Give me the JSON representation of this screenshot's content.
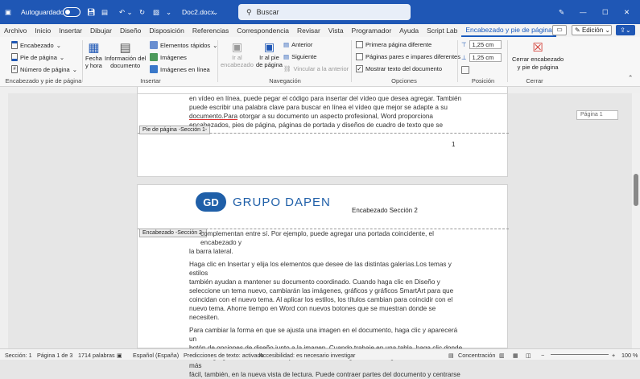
{
  "titlebar": {
    "autosave": "Autoguardado",
    "doc": "Doc2.docx",
    "search_placeholder": "Buscar",
    "chevron": "⌄"
  },
  "tabs": [
    "Archivo",
    "Inicio",
    "Insertar",
    "Dibujar",
    "Diseño",
    "Disposición",
    "Referencias",
    "Correspondencia",
    "Revisar",
    "Vista",
    "Programador",
    "Ayuda",
    "Script Lab",
    "Encabezado y pie de página"
  ],
  "ribbon_right": {
    "edit": "Edición"
  },
  "ribbon": {
    "header": "Encabezado",
    "footer": "Pie de página",
    "pagenum": "Número de página",
    "g1": "Encabezado y pie de página",
    "datetime1": "Fecha",
    "datetime2": "y hora",
    "docinfo1": "Información del",
    "docinfo2": "documento",
    "quick": "Elementos rápidos",
    "images": "Imágenes",
    "online": "Imágenes en línea",
    "g2": "Insertar",
    "goto_header1": "Ir al",
    "goto_header2": "encabezado",
    "goto_footer1": "Ir al pie",
    "goto_footer2": "de página",
    "prev": "Anterior",
    "next": "Siguiente",
    "link": "Vincular a la anterior",
    "g3": "Navegación",
    "first": "Primera página diferente",
    "oddeven": "Páginas pares e impares diferentes",
    "showtext": "Mostrar texto del documento",
    "g4": "Opciones",
    "top": "1,25 cm",
    "bottom": "1,25 cm",
    "g5": "Posición",
    "close1": "Cerrar encabezado",
    "close2": "y pie de página",
    "g6": "Cerrar"
  },
  "page1": {
    "l1": "en vídeo en línea, puede pegar el código para insertar del vídeo que desea agregar. También",
    "l2": "puede escribir una palabra clave para buscar en línea el vídeo que mejor se adapte a su",
    "l3a": "documento.Para",
    "l3b": " otorgar a su documento un aspecto profesional, Word proporciona",
    "l4": "encabezados, pies de página, páginas de portada y diseños de cuadro de texto que se",
    "footer_tag": "Pie de página -Sección 1-",
    "pagenum": "1"
  },
  "page2": {
    "logo_letters": "GD",
    "logo_text": "GRUPO DAPEN",
    "header_text": "Encabezado Sección 2",
    "header_tag": "Encabezado -Sección 2-",
    "p0a": "complementan entre sí. Por ejemplo, puede agregar una portada coincidente, el encabezado y",
    "p0b": "la barra lateral.",
    "p1": [
      "Haga clic en Insertar y elija los elementos que desee de las distintas galerías.Los temas y estilos",
      "también ayudan a mantener su documento coordinado. Cuando haga clic en Diseño y",
      "seleccione un tema nuevo, cambiarán las imágenes, gráficos y gráficos SmartArt para que",
      "coincidan con el nuevo tema. Al aplicar los estilos, los títulos cambian para coincidir con el",
      "nuevo tema. Ahorre tiempo en Word con nuevos botones que se muestran donde se",
      "necesiten."
    ],
    "p2": [
      "Para cambiar la forma en que se ajusta una imagen en el documento, haga clic y aparecerá un",
      "botón de opciones de diseño junto a la imagen. Cuando trabaje en una tabla, haga clic donde",
      "desee agregar una fila o columna y, a continuación, haga clic en el signo más.La lectura es más",
      "fácil, también, en la nueva vista de lectura. Puede contraer partes del documento y centrarse"
    ]
  },
  "side_label": "Página 1",
  "status": {
    "section": "Sección: 1",
    "page": "Página 1 de 3",
    "words": "1714 palabras",
    "lang": "Español (España)",
    "predict": "Predicciones de texto: activado",
    "access": "Accesibilidad: es necesario investigar",
    "focus": "Concentración",
    "zoom": "100 %"
  }
}
